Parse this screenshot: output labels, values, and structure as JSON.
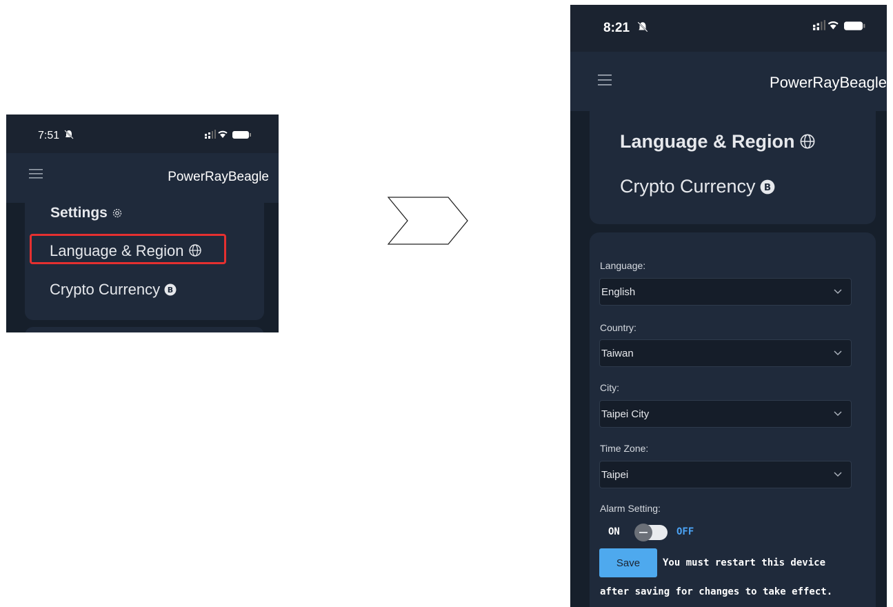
{
  "before": {
    "status": {
      "time": "7:51"
    },
    "header": {
      "title": "PowerRayBeagle"
    },
    "menu": {
      "settings_label": "Settings",
      "language_region_label": "Language & Region",
      "crypto_currency_label": "Crypto Currency"
    },
    "highlight_color": "#e53030"
  },
  "after": {
    "status": {
      "time": "8:21"
    },
    "header": {
      "title": "PowerRayBeagle"
    },
    "menu": {
      "language_region_label": "Language & Region",
      "crypto_currency_label": "Crypto Currency"
    },
    "form": {
      "language_label": "Language:",
      "language_value": "English",
      "country_label": "Country:",
      "country_value": "Taiwan",
      "city_label": "City:",
      "city_value": "Taipei City",
      "timezone_label": "Time Zone:",
      "timezone_value": "Taipei",
      "alarm_label": "Alarm Setting:",
      "alarm_on": "ON",
      "alarm_off": "OFF",
      "save_label": "Save",
      "note_line1": "You must restart this device",
      "note_line2": "after saving for changes to take effect."
    },
    "colors": {
      "accent": "#4ea9ee",
      "background": "#161f2b",
      "card": "#1f2a3b"
    }
  }
}
